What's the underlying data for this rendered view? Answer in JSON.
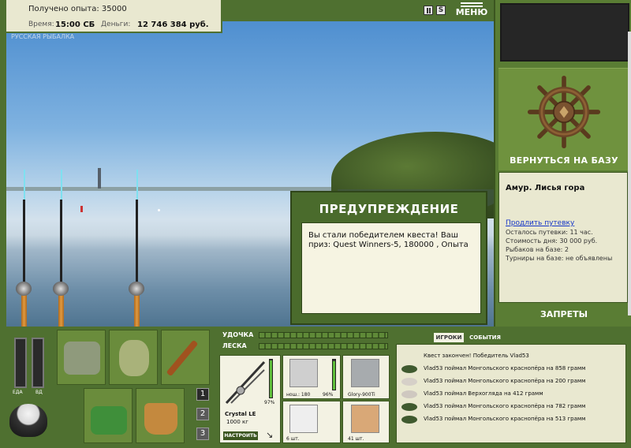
{
  "hud": {
    "experience_text": "Получено опыта: 35000",
    "time_label": "Время:",
    "time_value": "15:00 СБ",
    "money_label": "Деньги:",
    "money_value": "12 746 384 руб.",
    "watermark": "РУССКАЯ РЫБАЛКА"
  },
  "top_controls": {
    "sound_label": "S",
    "menu_label": "МЕНЮ"
  },
  "right_panel": {
    "return_label": "ВЕРНУТЬСЯ НА БАЗУ",
    "location_title": "Амур. Лисья гора",
    "extend_link": "Продлить путевку",
    "lines": [
      "Осталось путевки: 11 час.",
      "Стоимость дня: 30 000 руб.",
      "Рыбаков на базе: 2",
      "Турниры на базе: не объявлены"
    ],
    "bans_label": "ЗАПРЕТЫ"
  },
  "warning": {
    "title": "ПРЕДУПРЕЖДЕНИЕ",
    "message": "Вы стали победителем квеста! Ваш приз: Quest Winners-5, 180000 , Опыта"
  },
  "bottom": {
    "food_label": "ЕДА",
    "water_label": "ВД",
    "pages": [
      "1",
      "2",
      "3"
    ],
    "rod_meter_label": "УДОЧКА",
    "line_meter_label": "ЛЕСКА",
    "rod_name": "Crystal LE",
    "rod_capacity": "1000 кг",
    "rod_percent": "97%",
    "setup_label": "НАСТРОИТЬ",
    "reel_caption": "нош.: 180",
    "reel_percent": "96%",
    "line_caption": "Glory-900Ti",
    "hook_caption": "6 шт.",
    "bait_caption": "41 шт."
  },
  "events": {
    "tab_players": "ИГРОКИ",
    "tab_events": "СОБЫТИЯ",
    "rows": [
      "Квест закончен! Победитель Vlad53",
      "Vlad53 поймал Монгольского краснопёра на 858 грамм",
      "Vlad53 поймал Монгольского краснопёра на 200 грамм",
      "Vlad53 поймал Верхогляда на 412 грамм",
      "Vlad53 поймал Монгольского краснопёра на 782 грамм",
      "Vlad53 поймал Монгольского краснопёра на 513 грамм"
    ]
  },
  "colors": {
    "panel_green": "#4f7030",
    "paper": "#e9e8d0",
    "link_blue": "#1636c8"
  }
}
